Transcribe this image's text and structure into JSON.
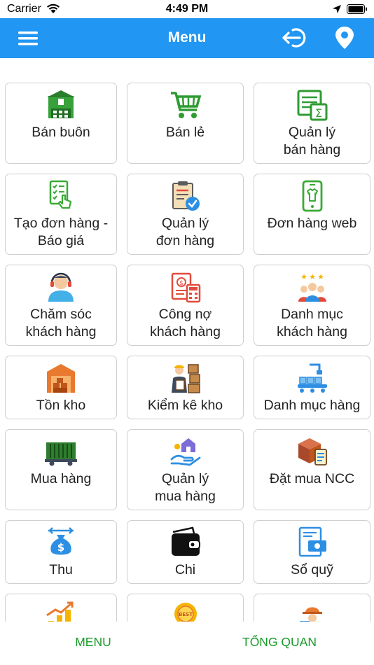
{
  "status_bar": {
    "carrier": "Carrier",
    "time": "4:49 PM"
  },
  "nav": {
    "title": "Menu",
    "left_icon": "hamburger-icon",
    "right_icons": [
      "logout-icon",
      "location-pin-icon"
    ]
  },
  "tiles": [
    {
      "label": "Bán buôn",
      "icon": "warehouse-icon"
    },
    {
      "label": "Bán lẻ",
      "icon": "shopping-cart-icon"
    },
    {
      "label": "Quản lý bán hàng",
      "icon": "spreadsheet-sum-icon"
    },
    {
      "label": "Tạo đơn hàng - Báo giá",
      "icon": "checklist-tap-icon"
    },
    {
      "label": "Quản lý đơn hàng",
      "icon": "clipboard-check-icon"
    },
    {
      "label": "Đơn hàng web",
      "icon": "phone-shirt-icon"
    },
    {
      "label": "Chăm sóc khách hàng",
      "icon": "support-agent-icon"
    },
    {
      "label": "Công nợ khách hàng",
      "icon": "invoice-calculator-icon"
    },
    {
      "label": "Danh mục khách hàng",
      "icon": "customer-stars-icon"
    },
    {
      "label": "Tồn kho",
      "icon": "storage-building-icon"
    },
    {
      "label": "Kiểm kê kho",
      "icon": "worker-boxes-icon"
    },
    {
      "label": "Danh mục hàng",
      "icon": "conveyor-boxes-icon"
    },
    {
      "label": "Mua hàng",
      "icon": "freight-car-icon"
    },
    {
      "label": "Quản lý mua hàng",
      "icon": "hand-house-icon"
    },
    {
      "label": "Đặt mua NCC",
      "icon": "box-checklist-icon"
    },
    {
      "label": "Thu",
      "icon": "money-bag-icon"
    },
    {
      "label": "Chi",
      "icon": "wallet-icon"
    },
    {
      "label": "Sổ quỹ",
      "icon": "cash-ledger-icon"
    },
    {
      "label": "",
      "icon": "growth-chart-icon"
    },
    {
      "label": "",
      "icon": "best-badge-icon"
    },
    {
      "label": "",
      "icon": "delivery-person-icon"
    }
  ],
  "bottom_tabs": {
    "menu": "MENU",
    "overview": "TỔNG QUAN"
  },
  "colors": {
    "nav_background": "#2196f3",
    "tab_text": "#1a9a2a",
    "tile_border": "#cfcfcf"
  }
}
